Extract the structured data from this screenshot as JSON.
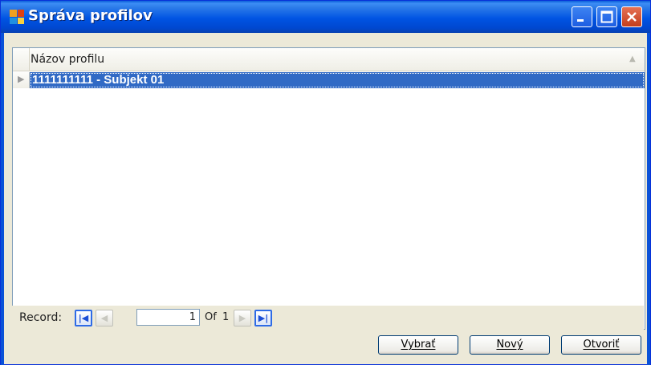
{
  "window": {
    "title": "Správa profilov",
    "controls": {
      "minimize": "minimize",
      "maximize": "maximize",
      "close": "close"
    }
  },
  "grid": {
    "column_header": "Názov profilu",
    "rows": [
      {
        "label": "1111111111 - Subjekt 01",
        "selected": true
      }
    ]
  },
  "navigator": {
    "record_label": "Record:",
    "position": "1",
    "of_label": "Of",
    "total": "1"
  },
  "buttons": {
    "select": "Vybrať",
    "new": "Nový",
    "open": "Otvoriť"
  },
  "icons": {
    "app": "app-window-icon",
    "first": "first-record-icon",
    "prev": "previous-record-icon",
    "next": "next-record-icon",
    "last": "last-record-icon"
  },
  "colors": {
    "titlebar": "#0054e3",
    "selection": "#316ac5",
    "close_button": "#c23e1c"
  }
}
